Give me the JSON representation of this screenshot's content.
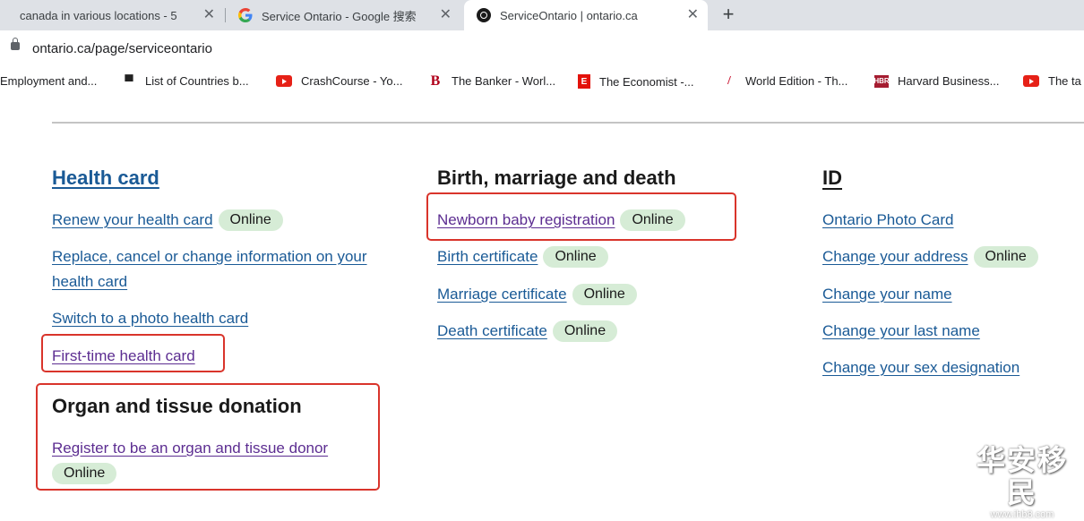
{
  "tabs": [
    {
      "title": "canada in various locations - 5",
      "icon": "none",
      "active": false
    },
    {
      "title": "Service Ontario - Google 搜索",
      "icon": "google-g-icon",
      "active": false
    },
    {
      "title": "ServiceOntario | ontario.ca",
      "icon": "ontario-logo-icon",
      "active": true
    }
  ],
  "tab_close_glyph": "✕",
  "new_tab_glyph": "+",
  "address": {
    "url": "ontario.ca/page/serviceontario"
  },
  "bookmarks": [
    {
      "label": "Employment and...",
      "icon": "none"
    },
    {
      "label": "List of Countries b...",
      "icon": "flag-icon"
    },
    {
      "label": "CrashCourse - Yo...",
      "icon": "youtube-icon"
    },
    {
      "label": "The Banker - Worl...",
      "icon": "banker-icon"
    },
    {
      "label": "The Economist -...",
      "icon": "economist-icon"
    },
    {
      "label": "World Edition - Th...",
      "icon": "ft-icon"
    },
    {
      "label": "Harvard Business...",
      "icon": "hbr-icon"
    },
    {
      "label": "The ta",
      "icon": "youtube-icon"
    }
  ],
  "bookmark_glyphs": {
    "banker": "B",
    "economist": "E",
    "ft": "/",
    "hbr": "HBR",
    "flag": "▀"
  },
  "badge_label": "Online",
  "health_card": {
    "heading": "Health card",
    "renew": "Renew your health card",
    "replace_line1": "Replace, cancel or change information on your",
    "replace_line2": "health card",
    "switch": "Switch to a photo health card",
    "first_time": "First-time health card"
  },
  "organ": {
    "heading": "Organ and tissue donation",
    "register": "Register to be an organ and tissue donor"
  },
  "birth_marriage_death": {
    "heading": "Birth, marriage and death",
    "newborn": "Newborn baby registration",
    "birth": "Birth certificate",
    "marriage": "Marriage certificate",
    "death": "Death certificate"
  },
  "id": {
    "heading": "ID",
    "photo_card": "Ontario Photo Card",
    "address": "Change your address",
    "name": "Change your name",
    "last_name": "Change your last name",
    "sex": "Change your sex designation"
  },
  "watermark": {
    "main": "华安移民",
    "sub": "www.ihb8.com"
  },
  "colors": {
    "link": "#1a5a96",
    "visited": "#5c2d91",
    "badge_bg": "#d6ecd6",
    "highlight_box": "#d9342b"
  }
}
